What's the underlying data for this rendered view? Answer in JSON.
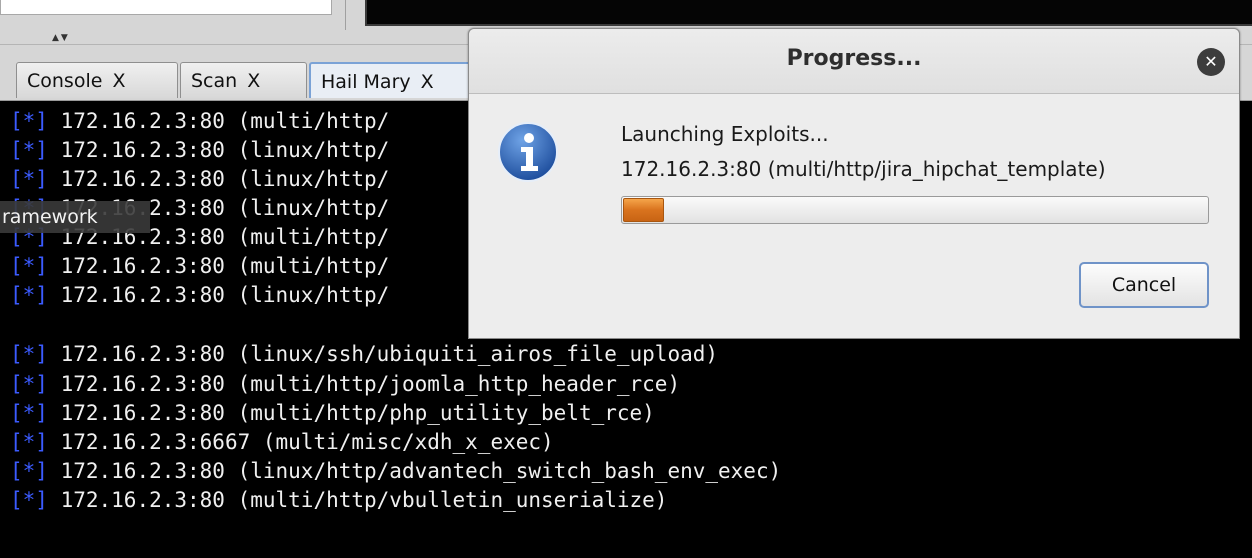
{
  "split_arrows": "▲▼",
  "tabs": [
    {
      "label": "Console",
      "close": "X"
    },
    {
      "label": "Scan",
      "close": "X"
    },
    {
      "label": "Hail Mary",
      "close": "X"
    }
  ],
  "tooltip": "ramework",
  "terminal": {
    "lines": [
      {
        "bullet": "[*]",
        "text": " 172.16.2.3:80 (multi/http/"
      },
      {
        "bullet": "[*]",
        "text": " 172.16.2.3:80 (linux/http/"
      },
      {
        "bullet": "[*]",
        "text": " 172.16.2.3:80 (linux/http/"
      },
      {
        "bullet": "[*]",
        "text": " 172.16.2.3:80 (linux/http/"
      },
      {
        "bullet": "[*]",
        "text": " 172.16.2.3:80 (multi/http/"
      },
      {
        "bullet": "[*]",
        "text": " 172.16.2.3:80 (multi/http/"
      },
      {
        "bullet": "[*]",
        "text": " 172.16.2.3:80 (linux/http/"
      },
      {
        "bullet": "[*]",
        "text": " 172.16.2.3:80 (linux/ssh/ubiquiti_airos_file_upload)"
      },
      {
        "bullet": "[*]",
        "text": " 172.16.2.3:80 (multi/http/joomla_http_header_rce)"
      },
      {
        "bullet": "[*]",
        "text": " 172.16.2.3:80 (multi/http/php_utility_belt_rce)"
      },
      {
        "bullet": "[*]",
        "text": " 172.16.2.3:6667 (multi/misc/xdh_x_exec)"
      },
      {
        "bullet": "[*]",
        "text": " 172.16.2.3:80 (linux/http/advantech_switch_bash_env_exec)"
      },
      {
        "bullet": "[*]",
        "text": " 172.16.2.3:80 (multi/http/vbulletin_unserialize)"
      }
    ]
  },
  "dialog": {
    "title": "Progress...",
    "close_glyph": "✕",
    "icon": "info-icon",
    "message": "Launching Exploits...",
    "detail": "172.16.2.3:80 (multi/http/jira_hipchat_template)",
    "progress": 0.07,
    "cancel_label": "Cancel"
  },
  "colors": {
    "bullet": "#3b5bff",
    "progress": "#d9731e",
    "info_icon": "#2a5db0"
  }
}
